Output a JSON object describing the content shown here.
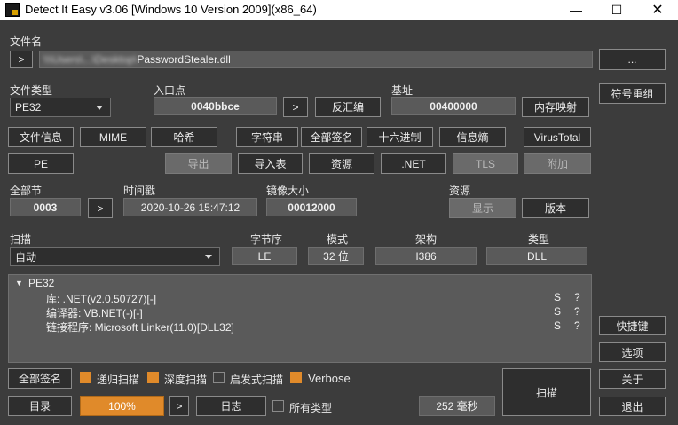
{
  "window": {
    "title": "Detect It Easy v3.06 [Windows 10 Version 2009](x86_64)"
  },
  "file": {
    "label": "文件名",
    "path_hidden": "\\\\\\Users\\...\\Desktop\\",
    "path_visible": "PasswordStealer.dll",
    "browse": "...",
    "go": ">"
  },
  "filetype": {
    "label": "文件类型",
    "value": "PE32"
  },
  "entry": {
    "label": "入口点",
    "value": "0040bbce",
    "go": ">",
    "disasm": "反汇编"
  },
  "base": {
    "label": "基址",
    "value": "00400000",
    "memmap": "内存映射"
  },
  "side": {
    "symbols": "符号重组",
    "shortcuts": "快捷键",
    "options": "选项",
    "about": "关于",
    "exit": "退出"
  },
  "tabs": {
    "fileinfo": "文件信息",
    "mime": "MIME",
    "hash": "哈希",
    "strings": "字符串",
    "signatures": "全部签名",
    "hex": "十六进制",
    "entropy": "信息熵",
    "virustotal": "VirusTotal"
  },
  "tabs2": {
    "pe": "PE",
    "export": "导出",
    "import": "导入表",
    "resources": "资源",
    "net": ".NET",
    "tls": "TLS",
    "overlay": "附加"
  },
  "sections": {
    "label": "全部节",
    "value": "0003",
    "go": ">"
  },
  "timestamp": {
    "label": "时间戳",
    "value": "2020-10-26 15:47:12"
  },
  "imagesize": {
    "label": "镜像大小",
    "value": "00012000"
  },
  "resource": {
    "label": "资源",
    "show": "显示",
    "version": "版本"
  },
  "scan": {
    "label": "扫描",
    "mode": "自动"
  },
  "endian": {
    "label": "字节序",
    "value": "LE"
  },
  "mode": {
    "label": "模式",
    "value": "32 位"
  },
  "arch": {
    "label": "架构",
    "value": "I386"
  },
  "type": {
    "label": "类型",
    "value": "DLL"
  },
  "results": {
    "root": "PE32",
    "items": [
      {
        "text": "库: .NET(v2.0.50727)[-]",
        "s": "S",
        "q": "?"
      },
      {
        "text": "编译器: VB.NET(-)[-]",
        "s": "S",
        "q": "?"
      },
      {
        "text": "链接程序: Microsoft Linker(11.0)[DLL32]",
        "s": "S",
        "q": "?"
      }
    ]
  },
  "bottom": {
    "allsig": "全部签名",
    "recursive": "递归扫描",
    "deep": "深度扫描",
    "heuristic": "启发式扫描",
    "verbose": "Verbose",
    "dir": "目录",
    "progress": "100%",
    "progress_value": 1.0,
    "go": ">",
    "log": "日志",
    "alltypes": "所有类型",
    "time": "252 毫秒",
    "scan": "扫描"
  },
  "colors": {
    "accent": "#e08a2a",
    "bg": "#3c3c3c"
  }
}
